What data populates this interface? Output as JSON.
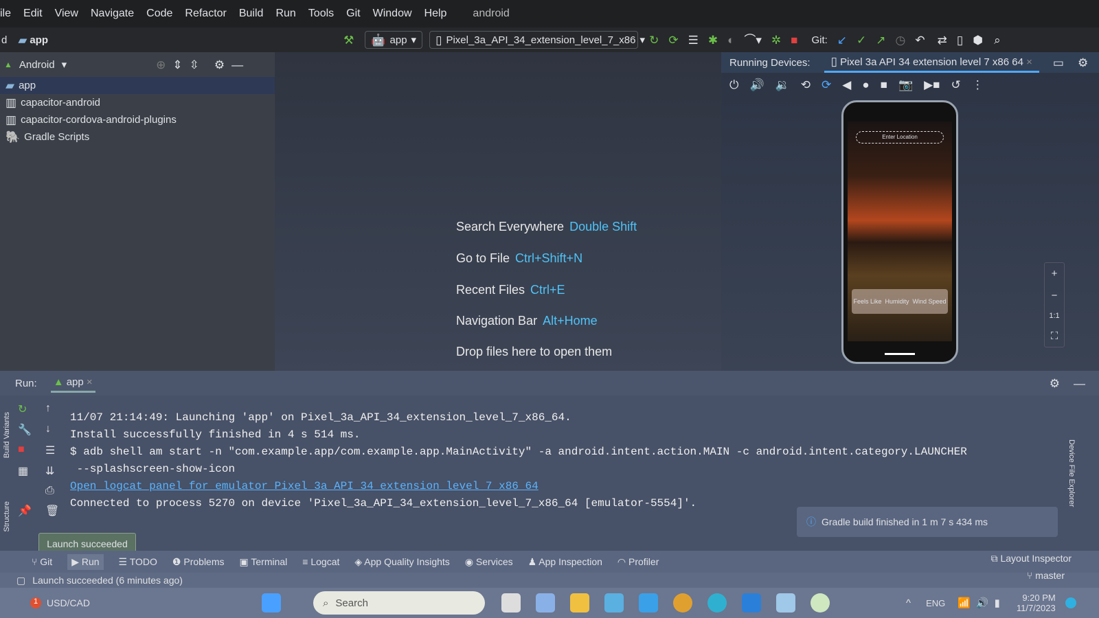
{
  "menu": {
    "items": [
      "ile",
      "Edit",
      "View",
      "Navigate",
      "Code",
      "Refactor",
      "Build",
      "Run",
      "Tools",
      "Git",
      "Window",
      "Help"
    ],
    "project_title": "android"
  },
  "toolbar": {
    "breadcrumb_prefix": "d",
    "breadcrumb_module": "app",
    "run_config": "app",
    "device": "Pixel_3a_API_34_extension_level_7_x86",
    "git_label": "Git:"
  },
  "project": {
    "view_mode": "Android",
    "items": [
      "app",
      "capacitor-android",
      "capacitor-cordova-android-plugins",
      "Gradle Scripts"
    ]
  },
  "editor": {
    "hints": [
      {
        "label": "Search Everywhere",
        "shortcut": "Double Shift"
      },
      {
        "label": "Go to File",
        "shortcut": "Ctrl+Shift+N"
      },
      {
        "label": "Recent Files",
        "shortcut": "Ctrl+E"
      },
      {
        "label": "Navigation Bar",
        "shortcut": "Alt+Home"
      }
    ],
    "drop_text": "Drop files here to open them"
  },
  "devices": {
    "title": "Running Devices:",
    "tab": "Pixel 3a API 34 extension level 7 x86 64",
    "zoom_reset": "1:1",
    "app": {
      "search_placeholder": "Enter Location",
      "stats": [
        "Feels Like",
        "Humidity",
        "Wind Speed"
      ]
    }
  },
  "run": {
    "label": "Run:",
    "tab": "app",
    "console": [
      "11/07 21:14:49: Launching 'app' on Pixel_3a_API_34_extension_level_7_x86_64.",
      "Install successfully finished in 4 s 514 ms.",
      "$ adb shell am start -n \"com.example.app/com.example.app.MainActivity\" -a android.intent.action.MAIN -c android.intent.category.LAUNCHER",
      " --splashscreen-show-icon"
    ],
    "logcat_link": "Open logcat panel for emulator Pixel 3a API 34 extension level 7 x86 64",
    "connected": "Connected to process 5270 on device 'Pixel_3a_API_34_extension_level_7_x86_64 [emulator-5554]'."
  },
  "notification": "Gradle build finished in 1 m 7 s 434 ms",
  "tooltip": "Launch succeeded",
  "tool_tabs": [
    "Git",
    "Run",
    "TODO",
    "Problems",
    "Terminal",
    "Logcat",
    "App Quality Insights",
    "Services",
    "App Inspection",
    "Profiler"
  ],
  "right_tools": {
    "layout_inspector": "Layout Inspector",
    "branch": "master"
  },
  "side_labels": [
    "Build Variants",
    "Structure",
    "Device File Explorer"
  ],
  "status": "Launch succeeded (6 minutes ago)",
  "taskbar": {
    "ticker": "USD/CAD",
    "badge": "1",
    "search": "Search",
    "lang": "ENG",
    "time": "9:20 PM",
    "date": "11/7/2023"
  }
}
